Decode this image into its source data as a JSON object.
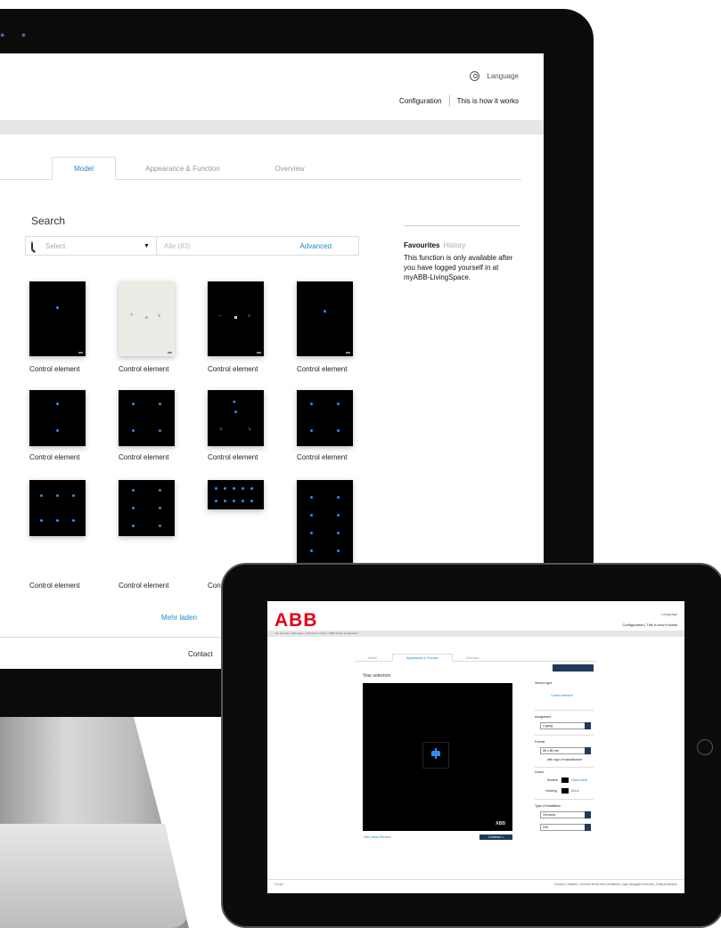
{
  "desktop": {
    "header": {
      "language_label": "Language",
      "link_configuration": "Configuration",
      "link_how_it_works": "This is how it works"
    },
    "tabs": [
      {
        "label": "Model",
        "active": true
      },
      {
        "label": "Appearance & Function",
        "active": false
      },
      {
        "label": "Overview",
        "active": false
      }
    ],
    "search": {
      "title": "Search",
      "select_placeholder": "Select",
      "filter_value": "Alle (83)",
      "advanced_label": "Advanced"
    },
    "favourites": {
      "title": "Favourites",
      "history_label": "History",
      "message": "This function is only available after you have logged yourself in at myABB-LivingSpace."
    },
    "products": [
      {
        "caption": "Control element"
      },
      {
        "caption": "Control element"
      },
      {
        "caption": "Control element"
      },
      {
        "caption": "Control element"
      },
      {
        "caption": "Control element"
      },
      {
        "caption": "Control element"
      },
      {
        "caption": "Control element"
      },
      {
        "caption": "Control element"
      },
      {
        "caption": "Control element"
      },
      {
        "caption": "Control element"
      },
      {
        "caption": "Con"
      }
    ],
    "load_more_label": "Mehr laden",
    "footer_contact": "Contact",
    "accent_color": "#1e88c9",
    "led_color": "#2a8ff0"
  },
  "tablet": {
    "brand": "ABB",
    "header": {
      "language_label": "Language",
      "links": "Configuration  |  This is how it works"
    },
    "breadcrumb": "You are here:  Start page  >  Services & Tools  >  ABB Switch configurator",
    "tabs": [
      {
        "label": "Model",
        "active": false
      },
      {
        "label": "Appearance & Function",
        "active": true
      },
      {
        "label": "Overview",
        "active": false
      }
    ],
    "selection_title": "Your selection",
    "preview_brand": "ABB",
    "bottom_links": "Hide views    Preview",
    "continue_label": "Continue  >",
    "sidebar": {
      "version_type_label": "Version type",
      "version_type_value": "Control element",
      "assignment_label": "Assignment",
      "assignment_value": "1-gang",
      "format_label": "Format",
      "format_value": "86 x 86 mm",
      "format_option": "with logo of manufacturer",
      "colour_label": "Colour",
      "surface_label": "Surface",
      "surface_value": "Glass black",
      "housing_label": "Housing",
      "housing_value": "Black",
      "installation_label": "Type of installation",
      "installation_country": "Germany",
      "installation_value": "DIN"
    },
    "footer_social": "f   in   yt   t",
    "footer_links": "Contact  |  Imprint  |  General terms and conditions  |  app navigation license  |  Data protection",
    "brand_color": "#e2001a",
    "dark_button_color": "#1f3b5c"
  }
}
